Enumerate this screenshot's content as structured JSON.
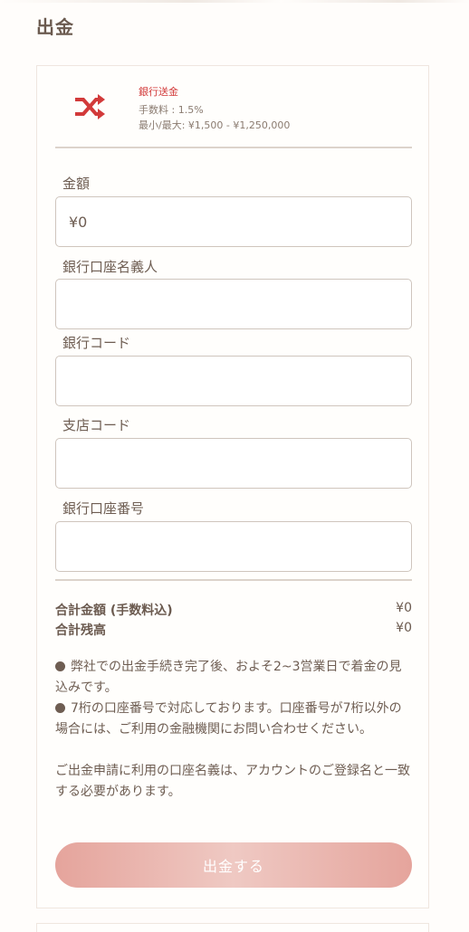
{
  "page": {
    "title": "出金"
  },
  "method": {
    "icon": "shuffle-icon",
    "name": "銀行送金",
    "fee": "手数料 : 1.5%",
    "range": "最小/最大: ¥1,500 - ¥1,250,000",
    "accent_color": "#d23a3a"
  },
  "form": {
    "amount": {
      "label": "金額",
      "placeholder": "¥0"
    },
    "account_holder": {
      "label": "銀行口座名義人",
      "placeholder": ""
    },
    "bank_code": {
      "label": "銀行コード",
      "placeholder": ""
    },
    "branch_code": {
      "label": "支店コード",
      "placeholder": ""
    },
    "account_number": {
      "label": "銀行口座番号",
      "placeholder": ""
    }
  },
  "summary": {
    "total_label": "合計金額 (手数料込)",
    "total_value": "¥0",
    "balance_label": "合計残高",
    "balance_value": "¥0"
  },
  "notes": {
    "note1": "弊社での出金手続き完了後、およそ2~3営業日で着金の見込みです。",
    "note2": "7桁の口座番号で対応しております。口座番号が7桁以外の場合には、ご利用の金融機関にお問い合わせください。",
    "note3": "ご出金申請に利用の口座名義は、アカウントのご登録名と一致する必要があります。"
  },
  "submit": {
    "label": "出金する",
    "color": "#e5a49c"
  }
}
